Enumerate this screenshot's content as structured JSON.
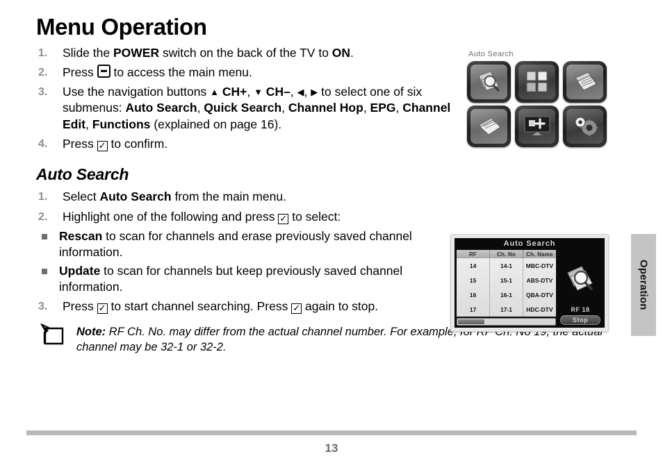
{
  "page": {
    "title": "Menu Operation",
    "number": "13",
    "side_tab": "Operation"
  },
  "steps": [
    {
      "num": "1.",
      "parts": [
        {
          "t": "Slide the ",
          "style": "normal"
        },
        {
          "t": "POWER",
          "style": "bold"
        },
        {
          "t": " switch on the back of the TV to ",
          "style": "normal"
        },
        {
          "t": "ON",
          "style": "bold"
        },
        {
          "t": ".",
          "style": "normal"
        }
      ]
    },
    {
      "num": "2.",
      "parts": [
        {
          "t": "Press ",
          "style": "normal"
        },
        {
          "t": "",
          "style": "key-minus"
        },
        {
          "t": " to access the main menu.",
          "style": "normal"
        }
      ]
    },
    {
      "num": "3.",
      "parts": [
        {
          "t": "Use the navigation buttons ",
          "style": "normal"
        },
        {
          "t": "▲",
          "style": "tri"
        },
        {
          "t": " CH+",
          "style": "bold"
        },
        {
          "t": ", ",
          "style": "normal"
        },
        {
          "t": "▼",
          "style": "tri"
        },
        {
          "t": " CH–",
          "style": "bold"
        },
        {
          "t": ", ",
          "style": "normal"
        },
        {
          "t": "◀",
          "style": "tri"
        },
        {
          "t": ", ",
          "style": "normal"
        },
        {
          "t": "▶",
          "style": "tri"
        },
        {
          "t": " to select one of six submenus: ",
          "style": "normal"
        },
        {
          "t": "Auto Search",
          "style": "bold"
        },
        {
          "t": ", ",
          "style": "normal"
        },
        {
          "t": "Quick Search",
          "style": "bold"
        },
        {
          "t": ", ",
          "style": "normal"
        },
        {
          "t": "Channel Hop",
          "style": "bold"
        },
        {
          "t": ", ",
          "style": "normal"
        },
        {
          "t": "EPG",
          "style": "bold"
        },
        {
          "t": ", ",
          "style": "normal"
        },
        {
          "t": "Channel Edit",
          "style": "bold"
        },
        {
          "t": ", ",
          "style": "normal"
        },
        {
          "t": "Functions",
          "style": "bold"
        },
        {
          "t": " (explained on page 16).",
          "style": "normal"
        }
      ]
    },
    {
      "num": "4.",
      "parts": [
        {
          "t": "Press ",
          "style": "normal"
        },
        {
          "t": "",
          "style": "check"
        },
        {
          "t": " to confirm.",
          "style": "normal"
        }
      ]
    }
  ],
  "section": {
    "heading": "Auto Search",
    "steps": [
      {
        "num": "1.",
        "parts": [
          {
            "t": "Select ",
            "style": "normal"
          },
          {
            "t": "Auto Search",
            "style": "bold"
          },
          {
            "t": " from the main menu.",
            "style": "normal"
          }
        ]
      },
      {
        "num": "2.",
        "parts": [
          {
            "t": "Highlight one of the following and press ",
            "style": "normal"
          },
          {
            "t": "",
            "style": "check"
          },
          {
            "t": " to select:",
            "style": "normal"
          }
        ]
      },
      {
        "num": "3.",
        "parts": [
          {
            "t": "Press ",
            "style": "normal"
          },
          {
            "t": "",
            "style": "check"
          },
          {
            "t": " to start channel searching. Press ",
            "style": "normal"
          },
          {
            "t": "",
            "style": "check"
          },
          {
            "t": " again to stop.",
            "style": "normal"
          }
        ]
      }
    ],
    "bullets": [
      {
        "parts": [
          {
            "t": "Rescan",
            "style": "bold"
          },
          {
            "t": " to scan for channels and erase previously saved channel information.",
            "style": "normal"
          }
        ]
      },
      {
        "parts": [
          {
            "t": "Update",
            "style": "bold"
          },
          {
            "t": " to scan for channels but keep previously saved channel information.",
            "style": "normal"
          }
        ]
      }
    ]
  },
  "note": {
    "label": "Note:",
    "text": " RF Ch. No. may differ from the actual channel number. For example, for RF Ch. No 19, the actual channel may be 32-1 or 32-2."
  },
  "menu_grid": {
    "label": "Auto Search",
    "tiles": [
      {
        "name": "auto-search",
        "icon": "magnifier-over-pages-icon"
      },
      {
        "name": "quick-search",
        "icon": "four-pane-grid-icon"
      },
      {
        "name": "channel-hop",
        "icon": "stacked-cards-icon"
      },
      {
        "name": "epg",
        "icon": "calendar-icon"
      },
      {
        "name": "channel-edit",
        "icon": "tv-plus-icon"
      },
      {
        "name": "functions",
        "icon": "gears-icon"
      }
    ]
  },
  "tv_screen": {
    "title": "Auto Search",
    "columns": [
      "RF",
      "Ch. No",
      "Ch. Name"
    ],
    "rows": [
      [
        "14",
        "14-1",
        "MBC-DTV"
      ],
      [
        "15",
        "15-1",
        "ABS-DTV"
      ],
      [
        "16",
        "16-1",
        "QBA-DTV"
      ],
      [
        "17",
        "17-1",
        "HDC-DTV"
      ]
    ],
    "rf_label": "RF 18",
    "stop_button": "Stop",
    "progress_percent": 27
  },
  "colors": {
    "rule": "#b8b8b8",
    "side_tab": "#c4c4c4",
    "step_number": "#8c8c8c",
    "bullet": "#6e6e6e",
    "page_number": "#6a6a6a"
  }
}
